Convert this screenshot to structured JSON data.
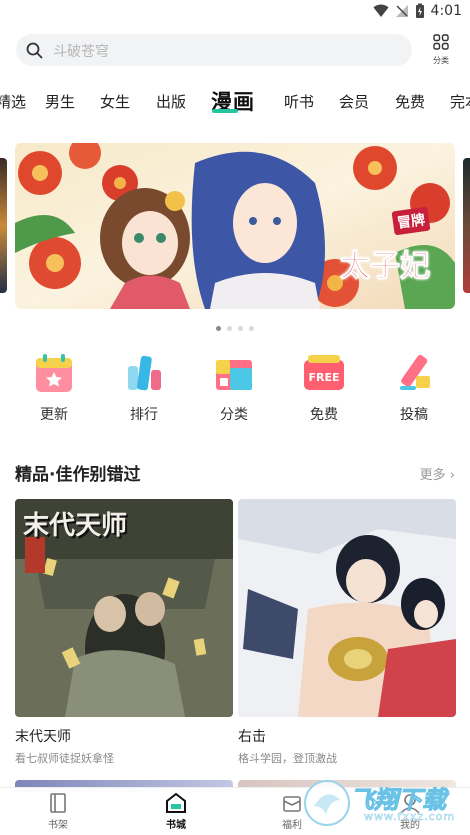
{
  "status_bar": {
    "time": "4:01"
  },
  "search": {
    "placeholder": "斗破苍穹",
    "category_label": "分类"
  },
  "tabs": [
    "精选",
    "男生",
    "女生",
    "出版",
    "漫画",
    "听书",
    "会员",
    "免费",
    "完本"
  ],
  "active_tab": "漫画",
  "banner": {
    "stamp": "冒牌",
    "title": "太子妃"
  },
  "carousel": {
    "count": 4,
    "active": 0
  },
  "quick_links": [
    {
      "label": "更新",
      "icon": "calendar-icon"
    },
    {
      "label": "排行",
      "icon": "ranking-icon"
    },
    {
      "label": "分类",
      "icon": "category-icon"
    },
    {
      "label": "免费",
      "icon": "free-icon"
    },
    {
      "label": "投稿",
      "icon": "submit-icon"
    }
  ],
  "section": {
    "title": "精品·佳作别错过",
    "more": "更多 ›"
  },
  "cards": [
    {
      "title": "末代天师",
      "subtitle": "看七叔师徒捉妖拿怪",
      "cover_text": "末代天师"
    },
    {
      "title": "右击",
      "subtitle": "格斗学园，登顶激战"
    }
  ],
  "bottom_nav": [
    {
      "label": "书架",
      "icon": "bookshelf-icon"
    },
    {
      "label": "书城",
      "icon": "bookstore-icon"
    },
    {
      "label": "福利",
      "icon": "gift-icon"
    },
    {
      "label": "我的",
      "icon": "profile-icon"
    }
  ],
  "watermark": {
    "text": "飞翔下载",
    "url": "www.fxxz.com"
  },
  "colors": {
    "accent": "#26c6a0",
    "search_bg": "#f2f3f5",
    "muted": "#999999"
  }
}
